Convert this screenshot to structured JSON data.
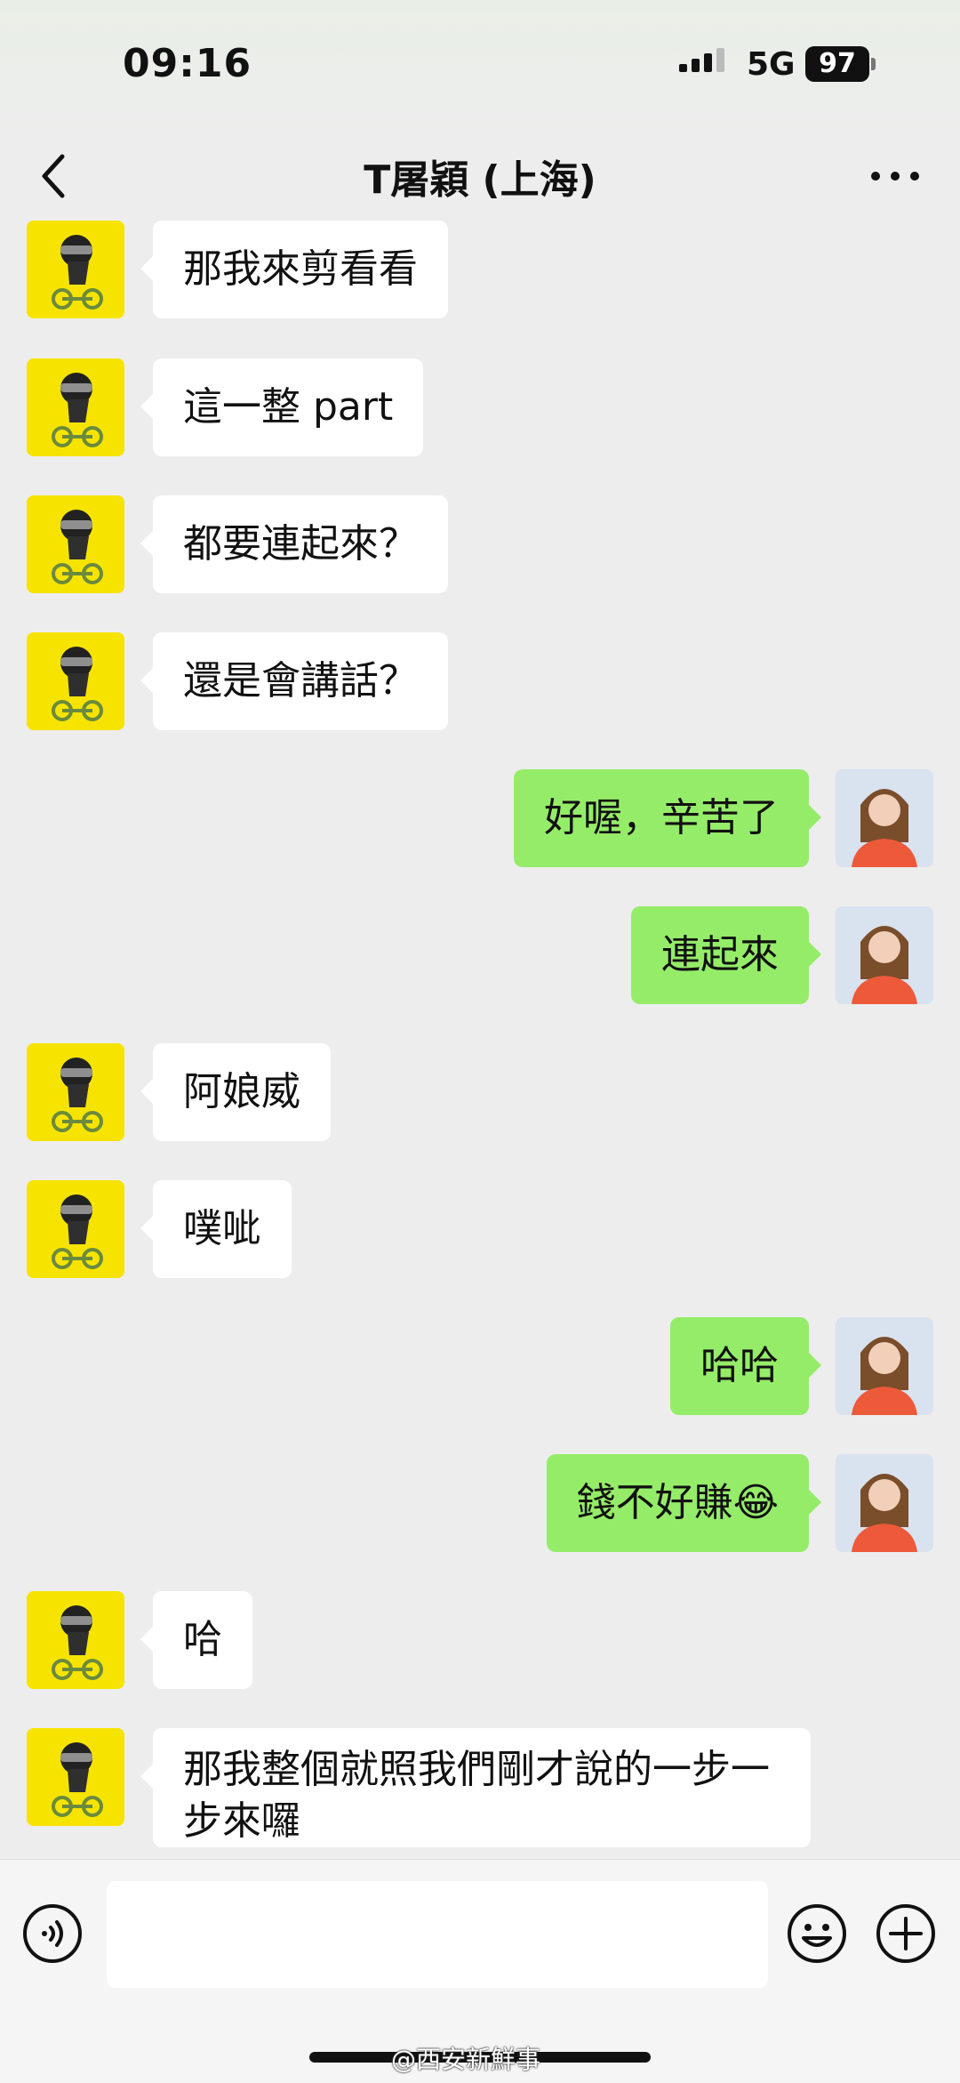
{
  "status": {
    "time": "09:16",
    "network": "5G",
    "battery": "97"
  },
  "header": {
    "title": "T屠穎 (上海)"
  },
  "messages": [
    {
      "side": "left",
      "text": "那我來剪看看"
    },
    {
      "side": "left",
      "text": "這一整 part"
    },
    {
      "side": "left",
      "text": "都要連起來？"
    },
    {
      "side": "left",
      "text": "還是會講話？"
    },
    {
      "side": "right",
      "text": "好喔，辛苦了"
    },
    {
      "side": "right",
      "text": "連起來"
    },
    {
      "side": "left",
      "text": "阿娘威"
    },
    {
      "side": "left",
      "text": "噗呲"
    },
    {
      "side": "right",
      "text": "哈哈"
    },
    {
      "side": "right",
      "text": "錢不好賺😂"
    },
    {
      "side": "left",
      "text": "哈"
    },
    {
      "side": "left",
      "text": "那我整個就照我們剛才說的一步一步來囉"
    }
  ],
  "composer": {
    "input_value": ""
  },
  "watermark": "@西安新鮮事",
  "colors": {
    "outgoing_bubble": "#95ec69",
    "incoming_bubble": "#ffffff",
    "background": "#ededed",
    "contact_avatar": "#f6e400"
  }
}
